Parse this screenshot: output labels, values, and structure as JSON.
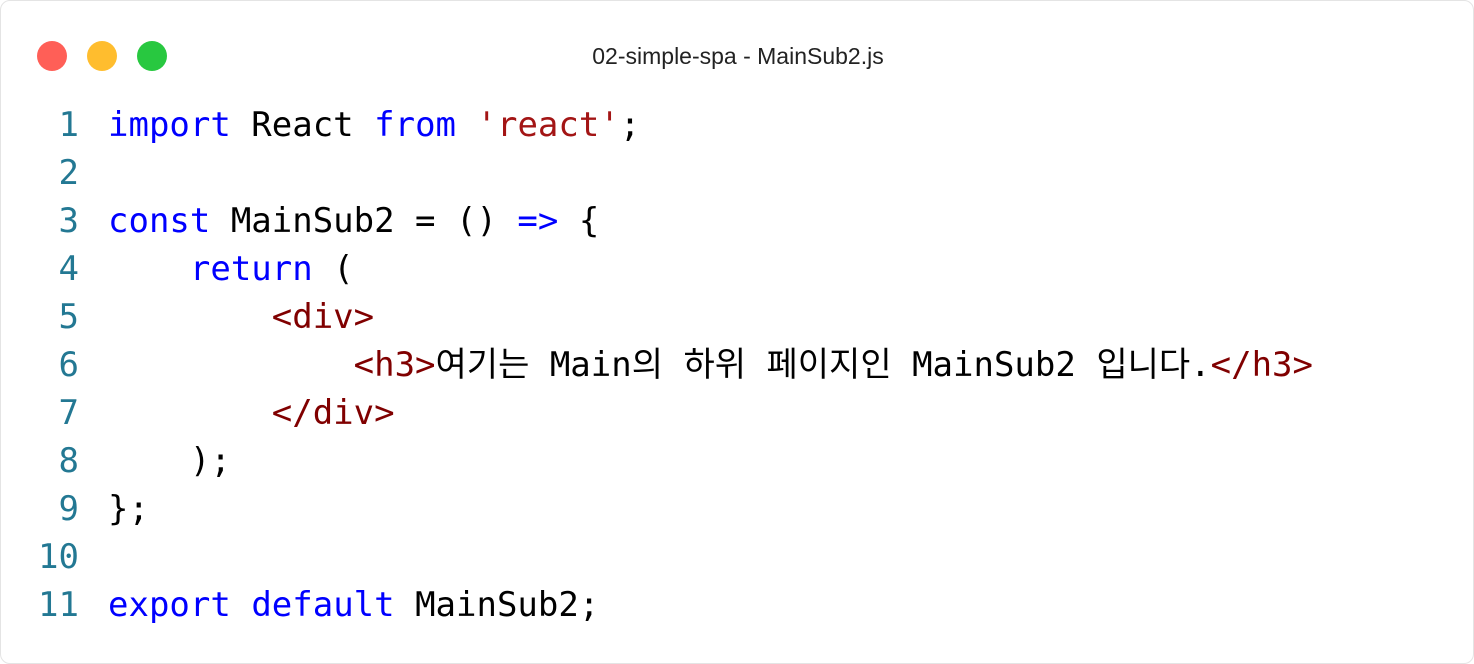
{
  "window": {
    "title": "02-simple-spa - MainSub2.js"
  },
  "colors": {
    "close": "#ff5f57",
    "minimize": "#ffbd2e",
    "maximize": "#28c840",
    "keyword": "#0000ff",
    "string": "#a31515",
    "tag": "#800000",
    "line_number": "#237893"
  },
  "code": {
    "lines": [
      {
        "num": "1",
        "tokens": [
          {
            "t": "import",
            "c": "kw"
          },
          {
            "t": " React ",
            "c": "txt"
          },
          {
            "t": "from",
            "c": "kw"
          },
          {
            "t": " ",
            "c": "txt"
          },
          {
            "t": "'react'",
            "c": "str"
          },
          {
            "t": ";",
            "c": "txt"
          }
        ]
      },
      {
        "num": "2",
        "tokens": []
      },
      {
        "num": "3",
        "tokens": [
          {
            "t": "const",
            "c": "kw"
          },
          {
            "t": " MainSub2 = () ",
            "c": "txt"
          },
          {
            "t": "=>",
            "c": "kw"
          },
          {
            "t": " {",
            "c": "txt"
          }
        ]
      },
      {
        "num": "4",
        "tokens": [
          {
            "t": "    ",
            "c": "txt"
          },
          {
            "t": "return",
            "c": "kw"
          },
          {
            "t": " (",
            "c": "txt"
          }
        ]
      },
      {
        "num": "5",
        "tokens": [
          {
            "t": "        ",
            "c": "txt"
          },
          {
            "t": "<div>",
            "c": "tag"
          }
        ]
      },
      {
        "num": "6",
        "tokens": [
          {
            "t": "            ",
            "c": "txt"
          },
          {
            "t": "<h3>",
            "c": "tag"
          },
          {
            "t": "여기는 Main의 하위 페이지인 MainSub2 입니다.",
            "c": "txt"
          },
          {
            "t": "</h3>",
            "c": "tag"
          }
        ]
      },
      {
        "num": "7",
        "tokens": [
          {
            "t": "        ",
            "c": "txt"
          },
          {
            "t": "</div>",
            "c": "tag"
          }
        ]
      },
      {
        "num": "8",
        "tokens": [
          {
            "t": "    );",
            "c": "txt"
          }
        ]
      },
      {
        "num": "9",
        "tokens": [
          {
            "t": "};",
            "c": "txt"
          }
        ]
      },
      {
        "num": "10",
        "tokens": []
      },
      {
        "num": "11",
        "tokens": [
          {
            "t": "export",
            "c": "kw"
          },
          {
            "t": " ",
            "c": "txt"
          },
          {
            "t": "default",
            "c": "kw"
          },
          {
            "t": " MainSub2;",
            "c": "txt"
          }
        ]
      }
    ]
  }
}
